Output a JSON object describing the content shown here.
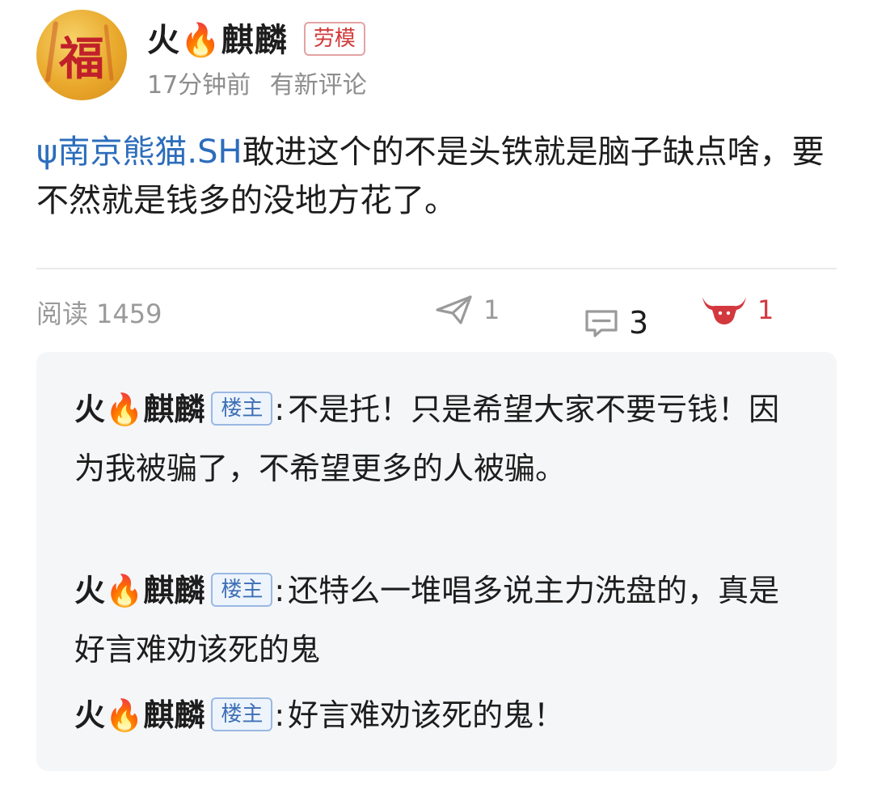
{
  "author": {
    "name": "火🔥麒麟",
    "honor_badge": "劳模",
    "avatar_icon": "fortune-calligraphy-avatar",
    "avatar_glyph": "福"
  },
  "meta": {
    "time": "17分钟前",
    "notice": "有新评论"
  },
  "post": {
    "mention_icon": "stock-prefix-icon",
    "mention_prefix": "ψ",
    "mention": "南京熊猫.SH",
    "text": "敢进这个的不是头铁就是脑子缺点啥，要不然就是钱多的没地方花了。"
  },
  "stats": {
    "read_label": "阅读",
    "read_count": "1459",
    "share_count": "1",
    "comment_count": "3",
    "like_count": "1",
    "like_color": "#d2383e"
  },
  "comments": [
    {
      "author": "火🔥麒麟",
      "tag": "楼主",
      "sep": ":",
      "text": "不是托！只是希望大家不要亏钱！因为我被骗了，不希望更多的人被骗。"
    },
    {
      "author": "火🔥麒麟",
      "tag": "楼主",
      "sep": ":",
      "text": "还特么一堆唱多说主力洗盘的，真是好言难劝该死的鬼"
    },
    {
      "author": "火🔥麒麟",
      "tag": "楼主",
      "sep": ":",
      "text": "好言难劝该死的鬼！"
    }
  ],
  "colors": {
    "mention": "#2c6dbc",
    "badge_honor": "#d23b3b",
    "tag_op": "#3d6fb5",
    "comment_bg": "#f5f6f8"
  }
}
